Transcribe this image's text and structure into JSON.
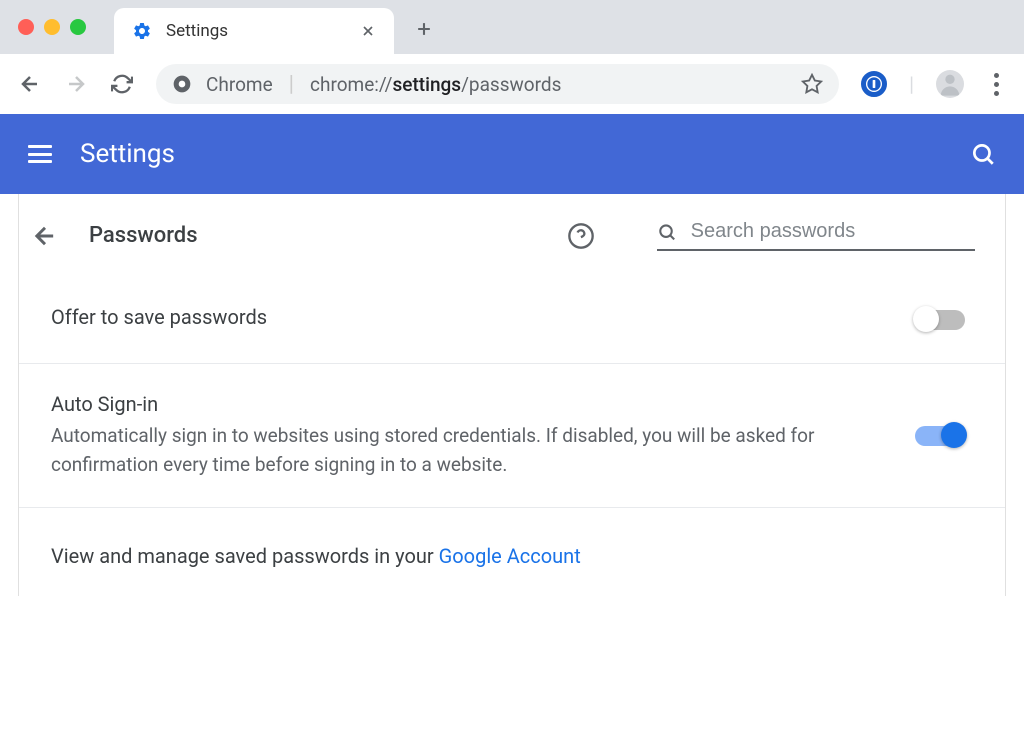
{
  "tab": {
    "title": "Settings"
  },
  "address": {
    "chrome_label": "Chrome",
    "url_prefix": "chrome://",
    "url_bold": "settings",
    "url_suffix": "/passwords"
  },
  "header": {
    "title": "Settings"
  },
  "subheader": {
    "title": "Passwords",
    "search_placeholder": "Search passwords"
  },
  "settings": {
    "offer_save": {
      "title": "Offer to save passwords"
    },
    "auto_signin": {
      "title": "Auto Sign-in",
      "desc": "Automatically sign in to websites using stored credentials. If disabled, you will be asked for confirmation every time before signing in to a website."
    }
  },
  "manage": {
    "prefix": "View and manage saved passwords in your ",
    "link": "Google Account"
  }
}
